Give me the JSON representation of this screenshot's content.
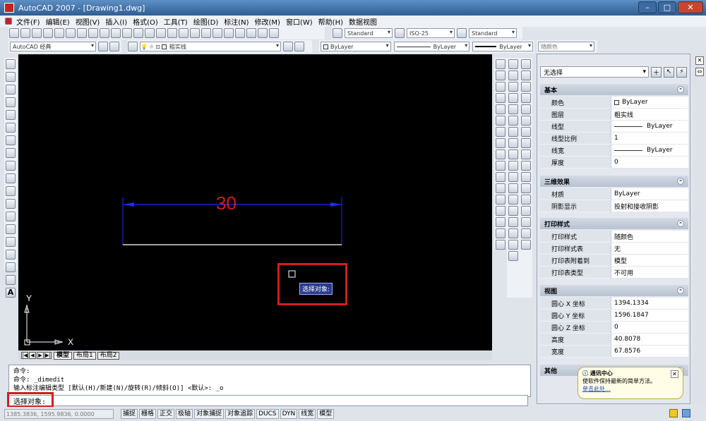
{
  "title": "AutoCAD 2007 - [Drawing1.dwg]",
  "menu": [
    "文件(F)",
    "编辑(E)",
    "视图(V)",
    "插入(I)",
    "格式(O)",
    "工具(T)",
    "绘图(D)",
    "标注(N)",
    "修改(M)",
    "窗口(W)",
    "帮助(H)",
    "数据视图"
  ],
  "styles": {
    "text_style": "Standard",
    "dim_style": "ISO-25",
    "table_style": "Standard"
  },
  "workspace": "AutoCAD 经典",
  "layer": "粗实线",
  "layer_props": {
    "color": "ByLayer",
    "linetype": "ByLayer",
    "lineweight": "ByLayer",
    "plotstyle": "随颜色"
  },
  "canvas": {
    "dimension_text": "30",
    "tooltip": "选择对象:",
    "ucs_y": "Y",
    "ucs_x": "X"
  },
  "sheet_tabs": [
    "模型",
    "布局1",
    "布局2"
  ],
  "properties": {
    "selection": "无选择",
    "sections": {
      "basic": "基本",
      "effects3d": "三维效果",
      "plot": "打印样式",
      "view": "视图",
      "misc": "其他"
    },
    "basic_rows": [
      {
        "k": "颜色",
        "v": "ByLayer"
      },
      {
        "k": "图层",
        "v": "粗实线"
      },
      {
        "k": "线型",
        "v": "ByLayer"
      },
      {
        "k": "线型比例",
        "v": "1"
      },
      {
        "k": "线宽",
        "v": "ByLayer"
      },
      {
        "k": "厚度",
        "v": "0"
      }
    ],
    "effects_rows": [
      {
        "k": "材质",
        "v": "ByLayer"
      },
      {
        "k": "阴影显示",
        "v": "投射和接收阴影"
      }
    ],
    "plot_rows": [
      {
        "k": "打印样式",
        "v": "随颜色"
      },
      {
        "k": "打印样式表",
        "v": "无"
      },
      {
        "k": "打印表附着到",
        "v": "模型"
      },
      {
        "k": "打印表类型",
        "v": "不可用"
      }
    ],
    "view_rows": [
      {
        "k": "圆心 X 坐标",
        "v": "1394.1334"
      },
      {
        "k": "圆心 Y 坐标",
        "v": "1596.1847"
      },
      {
        "k": "圆心 Z 坐标",
        "v": "0"
      },
      {
        "k": "高度",
        "v": "40.8078"
      },
      {
        "k": "宽度",
        "v": "67.8576"
      }
    ]
  },
  "command": {
    "line1": "命令:",
    "line2": "命令:  _dimedit",
    "line3": "输入标注编辑类型 [默认(H)/新建(N)/旋转(R)/倾斜(O)] <默认>: _o",
    "prompt": "选择对象:"
  },
  "status": {
    "coords": "1385.3836, 1595.9836, 0.0000",
    "buttons": [
      "捕捉",
      "栅格",
      "正交",
      "极轴",
      "对象捕捉",
      "对象追踪",
      "DUCS",
      "DYN",
      "线宽",
      "模型"
    ]
  },
  "balloon": {
    "title": "通讯中心",
    "body": "使软件保持最新的简单方法。",
    "link": "单击此处..."
  },
  "colors": {
    "canvas": "#000000",
    "dimension": "#1a2cff",
    "dim_text": "#d21c1c",
    "highlight": "#d41d1d"
  }
}
